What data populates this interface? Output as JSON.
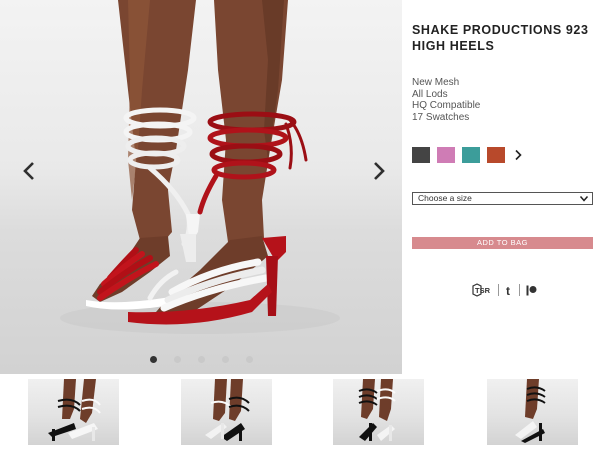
{
  "product": {
    "title": "SHAKE PRODUCTIONS 923 HIGH HEELS",
    "features": [
      "New Mesh",
      "All Lods",
      "HQ Compatible",
      "17 Swatches"
    ]
  },
  "swatches": {
    "colors": [
      "#444444",
      "#cf7cb5",
      "#3c9d9a",
      "#b8492b"
    ],
    "more_icon": "chevron-right-icon"
  },
  "size_select": {
    "placeholder": "Choose a size",
    "icon": "chevron-down-icon"
  },
  "cart": {
    "add_label": "ADD TO BAG",
    "color": "#d78a8e"
  },
  "social": {
    "icons": [
      "tsr-icon",
      "tumblr-icon",
      "patreon-icon"
    ],
    "tsr_label": "TSR",
    "tumblr_label": "t"
  },
  "gallery": {
    "prev_icon": "chevron-left-icon",
    "next_icon": "chevron-right-icon",
    "slide_count": 5,
    "active_slide": 1
  },
  "thumbnails": {
    "count": 4
  }
}
